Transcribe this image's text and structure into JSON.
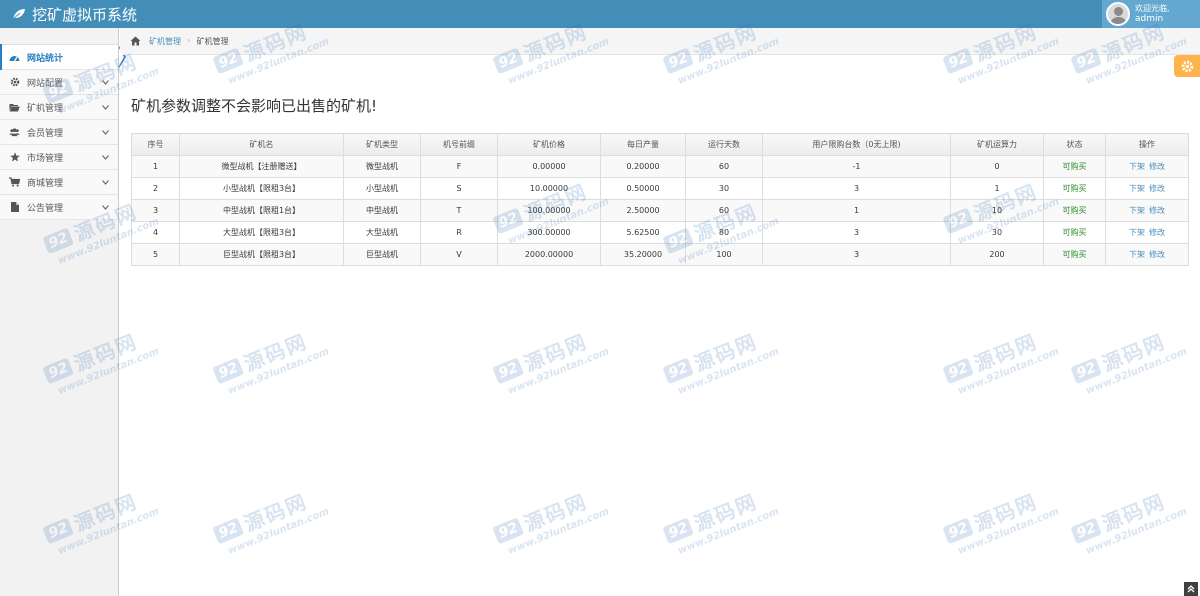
{
  "app": {
    "title": "挖矿虚拟币系统"
  },
  "user": {
    "welcome": "欢迎光临,",
    "name": "admin"
  },
  "sidebar": {
    "items": [
      {
        "label": "网站统计",
        "icon": "dashboard-icon",
        "active": true
      },
      {
        "label": "网站配置",
        "icon": "gear-icon"
      },
      {
        "label": "矿机管理",
        "icon": "folder-open-icon"
      },
      {
        "label": "会员管理",
        "icon": "users-icon"
      },
      {
        "label": "市场管理",
        "icon": "star-icon"
      },
      {
        "label": "商城管理",
        "icon": "cart-icon"
      },
      {
        "label": "公告管理",
        "icon": "file-icon"
      }
    ]
  },
  "breadcrumb": {
    "parent": "矿机管理",
    "current": "矿机管理"
  },
  "main": {
    "title": "矿机参数调整不会影响已出售的矿机!",
    "table": {
      "headers": [
        "序号",
        "矿机名",
        "矿机类型",
        "机号前缀",
        "矿机价格",
        "每日产量",
        "运行天数",
        "用户限购台数（0无上限)",
        "矿机运算力",
        "状态",
        "操作"
      ],
      "rows": [
        {
          "id": "1",
          "name": "微型战机【注册赠送】",
          "type": "微型战机",
          "prefix": "F",
          "price": "0.00000",
          "daily": "0.20000",
          "days": "60",
          "limit": "-1",
          "power": "0",
          "status": "可购买",
          "op_off": "下架",
          "op_edit": "修改"
        },
        {
          "id": "2",
          "name": "小型战机【限租3台】",
          "type": "小型战机",
          "prefix": "S",
          "price": "10.00000",
          "daily": "0.50000",
          "days": "30",
          "limit": "3",
          "power": "1",
          "status": "可购买",
          "op_off": "下架",
          "op_edit": "修改"
        },
        {
          "id": "3",
          "name": "中型战机【限租1台】",
          "type": "中型战机",
          "prefix": "T",
          "price": "100.00000",
          "daily": "2.50000",
          "days": "60",
          "limit": "1",
          "power": "10",
          "status": "可购买",
          "op_off": "下架",
          "op_edit": "修改"
        },
        {
          "id": "4",
          "name": "大型战机【限租3台】",
          "type": "大型战机",
          "prefix": "R",
          "price": "300.00000",
          "daily": "5.62500",
          "days": "80",
          "limit": "3",
          "power": "30",
          "status": "可购买",
          "op_off": "下架",
          "op_edit": "修改"
        },
        {
          "id": "5",
          "name": "巨型战机【限租3台】",
          "type": "巨型战机",
          "prefix": "V",
          "price": "2000.00000",
          "daily": "35.20000",
          "days": "100",
          "limit": "3",
          "power": "200",
          "status": "可购买",
          "op_off": "下架",
          "op_edit": "修改"
        }
      ]
    }
  },
  "watermark": {
    "badge": "92",
    "cn": "源码网",
    "url": "www.92luntan.com"
  },
  "colors": {
    "navbar": "#438eb9",
    "accent": "#2b7dbc",
    "link": "#4c8fbd",
    "status_ok": "#2e8b2e",
    "settings": "#ffb44b"
  }
}
